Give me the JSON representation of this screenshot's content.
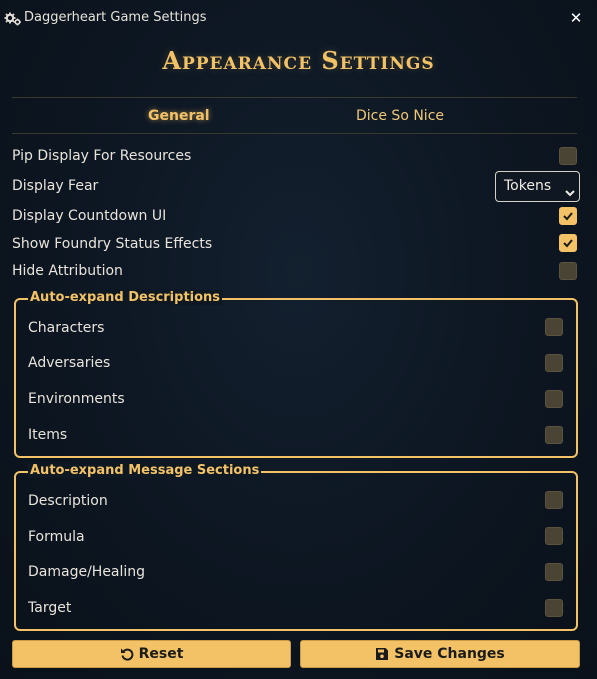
{
  "window": {
    "title": "Daggerheart Game Settings",
    "close_glyph": "✕"
  },
  "heading": "Appearance Settings",
  "tabs": [
    {
      "label": "General",
      "active": true
    },
    {
      "label": "Dice So Nice",
      "active": false
    }
  ],
  "settings": [
    {
      "label": "Pip Display For Resources",
      "type": "checkbox",
      "checked": false
    },
    {
      "label": "Display Fear",
      "type": "select",
      "value": "Tokens"
    },
    {
      "label": "Display Countdown UI",
      "type": "checkbox",
      "checked": true
    },
    {
      "label": "Show Foundry Status Effects",
      "type": "checkbox",
      "checked": true
    },
    {
      "label": "Hide Attribution",
      "type": "checkbox",
      "checked": false
    }
  ],
  "groups": [
    {
      "legend": "Auto-expand Descriptions",
      "items": [
        {
          "label": "Characters",
          "checked": false
        },
        {
          "label": "Adversaries",
          "checked": false
        },
        {
          "label": "Environments",
          "checked": false
        },
        {
          "label": "Items",
          "checked": false
        }
      ]
    },
    {
      "legend": "Auto-expand Message Sections",
      "items": [
        {
          "label": "Description",
          "checked": false
        },
        {
          "label": "Formula",
          "checked": false
        },
        {
          "label": "Damage/Healing",
          "checked": false
        },
        {
          "label": "Target",
          "checked": false
        }
      ]
    }
  ],
  "buttons": {
    "reset": {
      "label": "Reset",
      "icon": "undo-icon"
    },
    "save": {
      "label": "Save Changes",
      "icon": "save-icon"
    }
  },
  "colors": {
    "accent": "#f3c267",
    "background": "#0c1520",
    "checkbox_unchecked": "#4a4434"
  }
}
